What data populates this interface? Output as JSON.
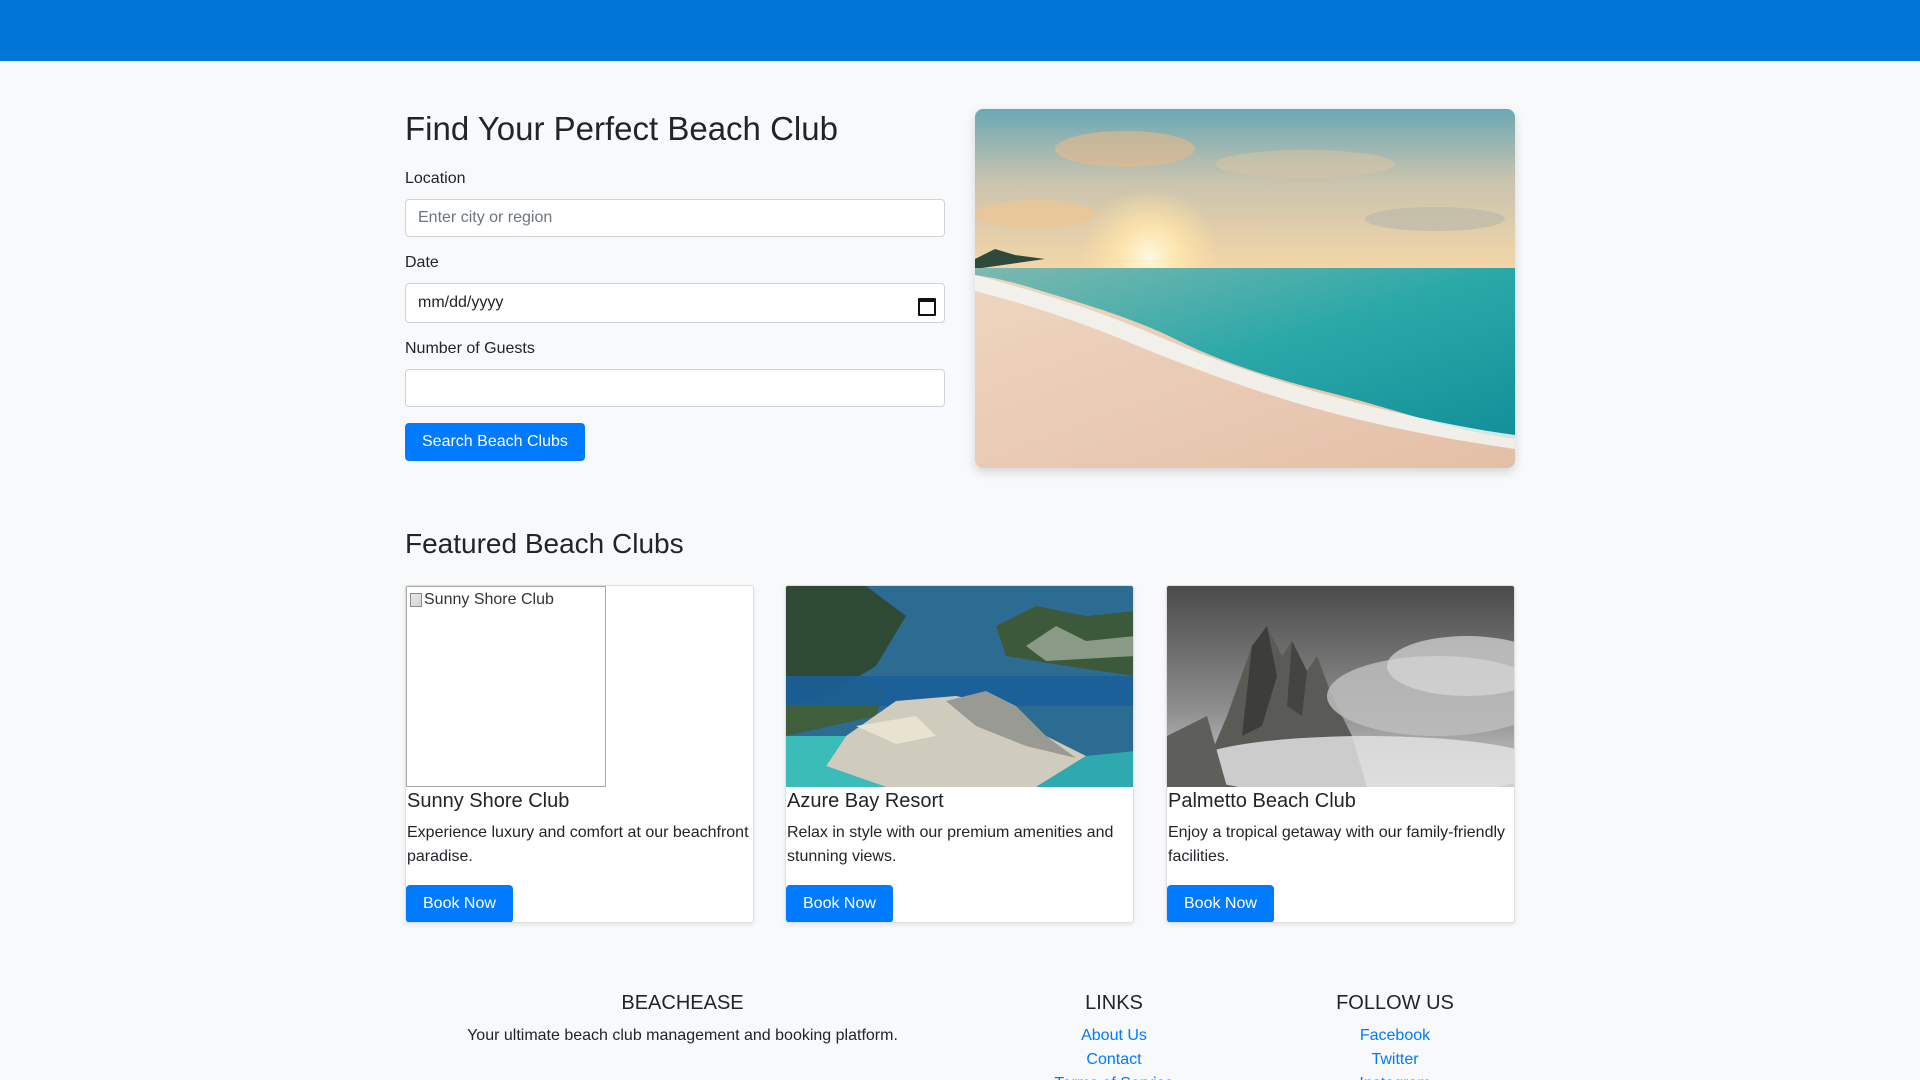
{
  "search": {
    "title": "Find Your Perfect Beach Club",
    "location_label": "Location",
    "location_placeholder": "Enter city or region",
    "date_label": "Date",
    "date_placeholder": "mm/dd/yyyy",
    "guests_label": "Number of Guests",
    "guests_value": "",
    "submit_label": "Search Beach Clubs"
  },
  "featured": {
    "title": "Featured Beach Clubs",
    "cards": [
      {
        "name": "Sunny Shore Club",
        "image_alt": "Sunny Shore Club",
        "description": "Experience luxury and comfort at our beachfront paradise.",
        "button": "Book Now"
      },
      {
        "name": "Azure Bay Resort",
        "description": "Relax in style with our premium amenities and stunning views.",
        "button": "Book Now"
      },
      {
        "name": "Palmetto Beach Club",
        "description": "Enjoy a tropical getaway with our family-friendly facilities.",
        "button": "Book Now"
      }
    ]
  },
  "footer": {
    "brand": "BEACHEASE",
    "tagline": "Your ultimate beach club management and booking platform.",
    "links_title": "LINKS",
    "links": [
      "About Us",
      "Contact",
      "Terms of Service"
    ],
    "follow_title": "FOLLOW US",
    "social": [
      "Facebook",
      "Twitter",
      "Instagram"
    ]
  },
  "colors": {
    "topbar": "#0275d8",
    "primary": "#007bff",
    "background": "#f8f9fa"
  }
}
